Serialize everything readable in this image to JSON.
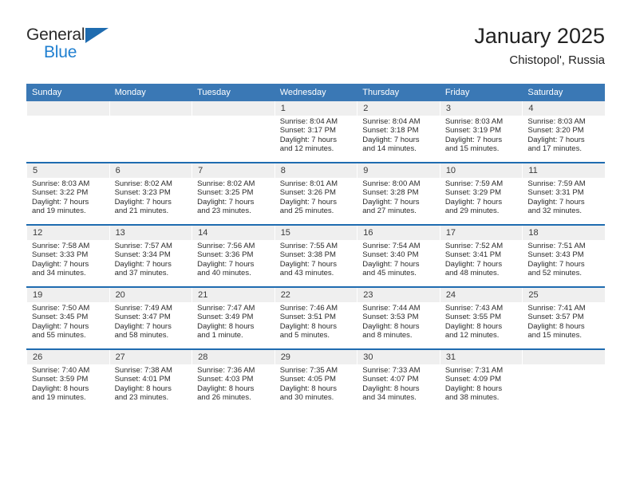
{
  "brand": {
    "name_top": "General",
    "name_bottom": "Blue",
    "triangle_color": "#1f6cb0",
    "blue_color": "#1f7fd0"
  },
  "header": {
    "title": "January 2025",
    "subtitle": "Chistopol', Russia"
  },
  "colors": {
    "header_blue": "#3a78b5",
    "row_divider": "#1f6cb0",
    "daynum_band": "#efefef"
  },
  "weekday_headers": [
    "Sunday",
    "Monday",
    "Tuesday",
    "Wednesday",
    "Thursday",
    "Friday",
    "Saturday"
  ],
  "weeks": [
    [
      {
        "day": "",
        "sunrise": "",
        "sunset": "",
        "daylight_1": "",
        "daylight_2": ""
      },
      {
        "day": "",
        "sunrise": "",
        "sunset": "",
        "daylight_1": "",
        "daylight_2": ""
      },
      {
        "day": "",
        "sunrise": "",
        "sunset": "",
        "daylight_1": "",
        "daylight_2": ""
      },
      {
        "day": "1",
        "sunrise": "Sunrise: 8:04 AM",
        "sunset": "Sunset: 3:17 PM",
        "daylight_1": "Daylight: 7 hours",
        "daylight_2": "and 12 minutes."
      },
      {
        "day": "2",
        "sunrise": "Sunrise: 8:04 AM",
        "sunset": "Sunset: 3:18 PM",
        "daylight_1": "Daylight: 7 hours",
        "daylight_2": "and 14 minutes."
      },
      {
        "day": "3",
        "sunrise": "Sunrise: 8:03 AM",
        "sunset": "Sunset: 3:19 PM",
        "daylight_1": "Daylight: 7 hours",
        "daylight_2": "and 15 minutes."
      },
      {
        "day": "4",
        "sunrise": "Sunrise: 8:03 AM",
        "sunset": "Sunset: 3:20 PM",
        "daylight_1": "Daylight: 7 hours",
        "daylight_2": "and 17 minutes."
      }
    ],
    [
      {
        "day": "5",
        "sunrise": "Sunrise: 8:03 AM",
        "sunset": "Sunset: 3:22 PM",
        "daylight_1": "Daylight: 7 hours",
        "daylight_2": "and 19 minutes."
      },
      {
        "day": "6",
        "sunrise": "Sunrise: 8:02 AM",
        "sunset": "Sunset: 3:23 PM",
        "daylight_1": "Daylight: 7 hours",
        "daylight_2": "and 21 minutes."
      },
      {
        "day": "7",
        "sunrise": "Sunrise: 8:02 AM",
        "sunset": "Sunset: 3:25 PM",
        "daylight_1": "Daylight: 7 hours",
        "daylight_2": "and 23 minutes."
      },
      {
        "day": "8",
        "sunrise": "Sunrise: 8:01 AM",
        "sunset": "Sunset: 3:26 PM",
        "daylight_1": "Daylight: 7 hours",
        "daylight_2": "and 25 minutes."
      },
      {
        "day": "9",
        "sunrise": "Sunrise: 8:00 AM",
        "sunset": "Sunset: 3:28 PM",
        "daylight_1": "Daylight: 7 hours",
        "daylight_2": "and 27 minutes."
      },
      {
        "day": "10",
        "sunrise": "Sunrise: 7:59 AM",
        "sunset": "Sunset: 3:29 PM",
        "daylight_1": "Daylight: 7 hours",
        "daylight_2": "and 29 minutes."
      },
      {
        "day": "11",
        "sunrise": "Sunrise: 7:59 AM",
        "sunset": "Sunset: 3:31 PM",
        "daylight_1": "Daylight: 7 hours",
        "daylight_2": "and 32 minutes."
      }
    ],
    [
      {
        "day": "12",
        "sunrise": "Sunrise: 7:58 AM",
        "sunset": "Sunset: 3:33 PM",
        "daylight_1": "Daylight: 7 hours",
        "daylight_2": "and 34 minutes."
      },
      {
        "day": "13",
        "sunrise": "Sunrise: 7:57 AM",
        "sunset": "Sunset: 3:34 PM",
        "daylight_1": "Daylight: 7 hours",
        "daylight_2": "and 37 minutes."
      },
      {
        "day": "14",
        "sunrise": "Sunrise: 7:56 AM",
        "sunset": "Sunset: 3:36 PM",
        "daylight_1": "Daylight: 7 hours",
        "daylight_2": "and 40 minutes."
      },
      {
        "day": "15",
        "sunrise": "Sunrise: 7:55 AM",
        "sunset": "Sunset: 3:38 PM",
        "daylight_1": "Daylight: 7 hours",
        "daylight_2": "and 43 minutes."
      },
      {
        "day": "16",
        "sunrise": "Sunrise: 7:54 AM",
        "sunset": "Sunset: 3:40 PM",
        "daylight_1": "Daylight: 7 hours",
        "daylight_2": "and 45 minutes."
      },
      {
        "day": "17",
        "sunrise": "Sunrise: 7:52 AM",
        "sunset": "Sunset: 3:41 PM",
        "daylight_1": "Daylight: 7 hours",
        "daylight_2": "and 48 minutes."
      },
      {
        "day": "18",
        "sunrise": "Sunrise: 7:51 AM",
        "sunset": "Sunset: 3:43 PM",
        "daylight_1": "Daylight: 7 hours",
        "daylight_2": "and 52 minutes."
      }
    ],
    [
      {
        "day": "19",
        "sunrise": "Sunrise: 7:50 AM",
        "sunset": "Sunset: 3:45 PM",
        "daylight_1": "Daylight: 7 hours",
        "daylight_2": "and 55 minutes."
      },
      {
        "day": "20",
        "sunrise": "Sunrise: 7:49 AM",
        "sunset": "Sunset: 3:47 PM",
        "daylight_1": "Daylight: 7 hours",
        "daylight_2": "and 58 minutes."
      },
      {
        "day": "21",
        "sunrise": "Sunrise: 7:47 AM",
        "sunset": "Sunset: 3:49 PM",
        "daylight_1": "Daylight: 8 hours",
        "daylight_2": "and 1 minute."
      },
      {
        "day": "22",
        "sunrise": "Sunrise: 7:46 AM",
        "sunset": "Sunset: 3:51 PM",
        "daylight_1": "Daylight: 8 hours",
        "daylight_2": "and 5 minutes."
      },
      {
        "day": "23",
        "sunrise": "Sunrise: 7:44 AM",
        "sunset": "Sunset: 3:53 PM",
        "daylight_1": "Daylight: 8 hours",
        "daylight_2": "and 8 minutes."
      },
      {
        "day": "24",
        "sunrise": "Sunrise: 7:43 AM",
        "sunset": "Sunset: 3:55 PM",
        "daylight_1": "Daylight: 8 hours",
        "daylight_2": "and 12 minutes."
      },
      {
        "day": "25",
        "sunrise": "Sunrise: 7:41 AM",
        "sunset": "Sunset: 3:57 PM",
        "daylight_1": "Daylight: 8 hours",
        "daylight_2": "and 15 minutes."
      }
    ],
    [
      {
        "day": "26",
        "sunrise": "Sunrise: 7:40 AM",
        "sunset": "Sunset: 3:59 PM",
        "daylight_1": "Daylight: 8 hours",
        "daylight_2": "and 19 minutes."
      },
      {
        "day": "27",
        "sunrise": "Sunrise: 7:38 AM",
        "sunset": "Sunset: 4:01 PM",
        "daylight_1": "Daylight: 8 hours",
        "daylight_2": "and 23 minutes."
      },
      {
        "day": "28",
        "sunrise": "Sunrise: 7:36 AM",
        "sunset": "Sunset: 4:03 PM",
        "daylight_1": "Daylight: 8 hours",
        "daylight_2": "and 26 minutes."
      },
      {
        "day": "29",
        "sunrise": "Sunrise: 7:35 AM",
        "sunset": "Sunset: 4:05 PM",
        "daylight_1": "Daylight: 8 hours",
        "daylight_2": "and 30 minutes."
      },
      {
        "day": "30",
        "sunrise": "Sunrise: 7:33 AM",
        "sunset": "Sunset: 4:07 PM",
        "daylight_1": "Daylight: 8 hours",
        "daylight_2": "and 34 minutes."
      },
      {
        "day": "31",
        "sunrise": "Sunrise: 7:31 AM",
        "sunset": "Sunset: 4:09 PM",
        "daylight_1": "Daylight: 8 hours",
        "daylight_2": "and 38 minutes."
      },
      {
        "day": "",
        "sunrise": "",
        "sunset": "",
        "daylight_1": "",
        "daylight_2": ""
      }
    ]
  ]
}
